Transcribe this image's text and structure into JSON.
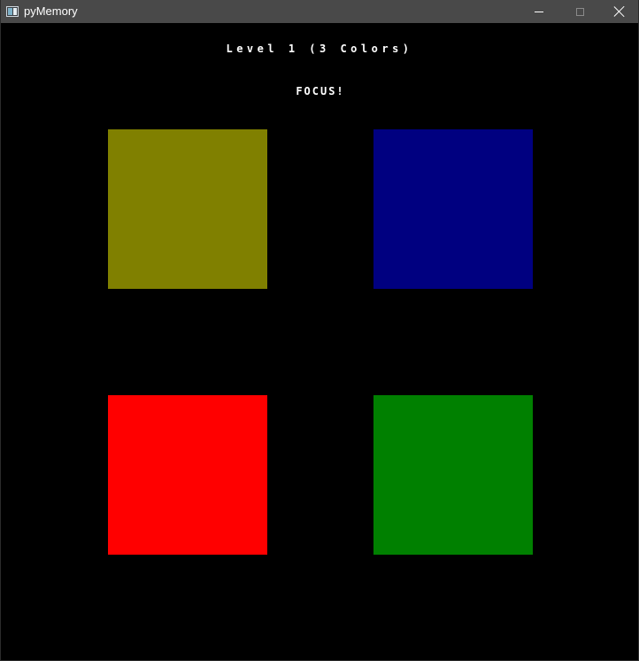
{
  "window": {
    "title": "pyMemory",
    "icon": "app-window-icon",
    "controls": {
      "minimize_icon": "minimize-icon",
      "maximize_icon": "maximize-icon",
      "close_icon": "close-icon"
    }
  },
  "game": {
    "level_title": "Level 1 (3 Colors)",
    "status": "FOCUS!",
    "tiles": [
      {
        "name": "olive",
        "color": "#808000"
      },
      {
        "name": "navy",
        "color": "#000080"
      },
      {
        "name": "red",
        "color": "#ff0000"
      },
      {
        "name": "green",
        "color": "#008000"
      }
    ]
  },
  "colors": {
    "background": "#000000",
    "titlebar": "#494949",
    "text": "#ffffff"
  }
}
